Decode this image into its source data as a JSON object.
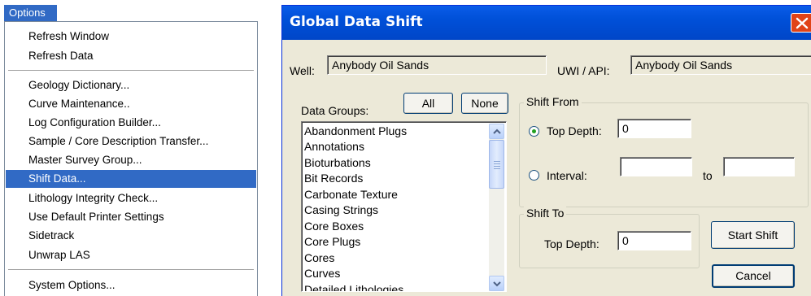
{
  "menu": {
    "title": "Options",
    "items": [
      {
        "label": "Refresh Window"
      },
      {
        "label": "Refresh Data"
      },
      {
        "label": "Geology Dictionary..."
      },
      {
        "label": "Curve Maintenance.."
      },
      {
        "label": "Log Configuration Builder..."
      },
      {
        "label": "Sample / Core Description Transfer..."
      },
      {
        "label": "Master Survey Group..."
      },
      {
        "label": "Shift Data..."
      },
      {
        "label": "Lithology Integrity Check..."
      },
      {
        "label": "Use Default Printer Settings"
      },
      {
        "label": "Sidetrack"
      },
      {
        "label": "Unwrap LAS"
      },
      {
        "label": "System Options..."
      }
    ],
    "highlighted": "Shift Data..."
  },
  "dialog": {
    "title": "Global Data Shift",
    "well_label": "Well:",
    "well_value": "Anybody Oil Sands",
    "uwi_label": "UWI / API:",
    "uwi_value": "Anybody Oil Sands",
    "data_groups_label": "Data Groups:",
    "all_button": "All",
    "none_button": "None",
    "data_groups": [
      "Abandonment Plugs",
      "Annotations",
      "Bioturbations",
      "Bit Records",
      "Carbonate Texture",
      "Casing Strings",
      "Core Boxes",
      "Core Plugs",
      "Cores",
      "Curves",
      "Detailed Lithologies"
    ],
    "shift_from": {
      "legend": "Shift From",
      "top_depth_label": "Top Depth:",
      "top_depth_value": "0",
      "interval_label": "Interval:",
      "interval_from": "",
      "to_label": "to",
      "interval_to": "",
      "selected": "Top Depth"
    },
    "shift_to": {
      "legend": "Shift To",
      "top_depth_label": "Top Depth:",
      "top_depth_value": "0"
    },
    "start_button": "Start Shift",
    "cancel_button": "Cancel"
  },
  "colors": {
    "menu_highlight": "#316ac5",
    "dialog_face": "#ece9d8",
    "titlebar": "#0054e3",
    "close_button": "#e04318"
  }
}
